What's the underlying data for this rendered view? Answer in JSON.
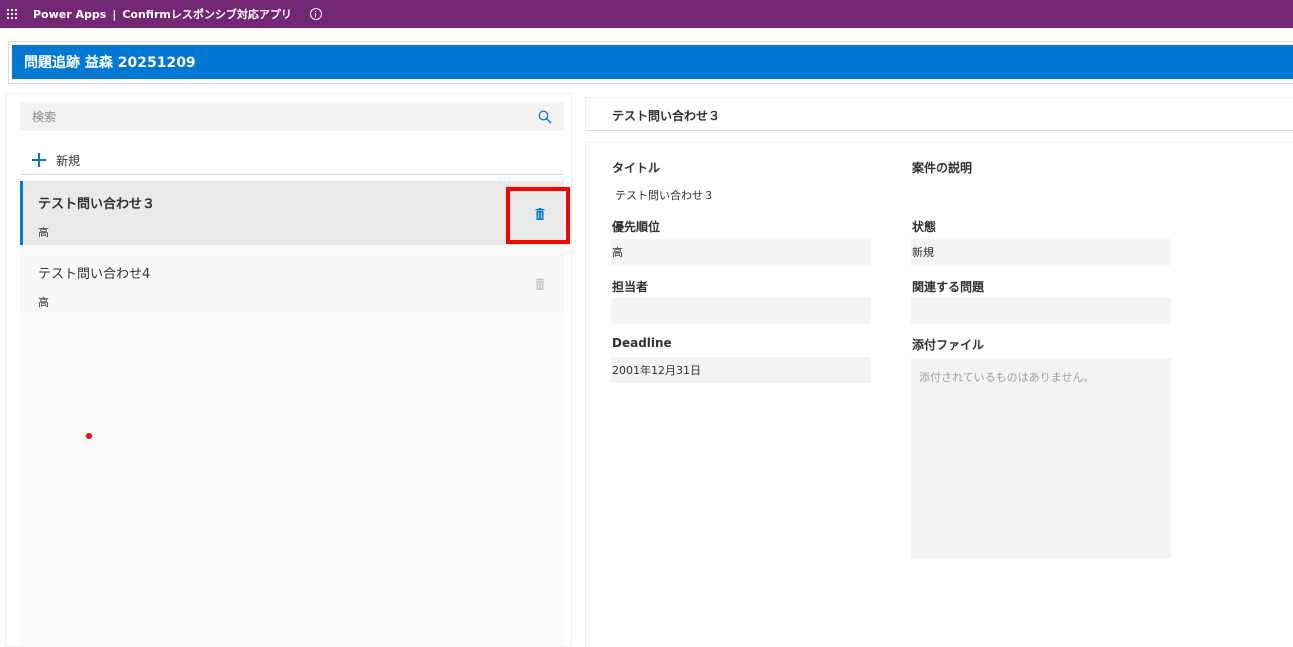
{
  "app": {
    "product": "Power Apps",
    "separator": "|",
    "app_name": "Confirmレスポンシブ対応アプリ"
  },
  "header": {
    "title": "問題追跡 益森 20251209"
  },
  "search": {
    "placeholder": "検索"
  },
  "toolbar": {
    "new_label": "新規"
  },
  "list": {
    "items": [
      {
        "title": "テスト問い合わせ３",
        "priority": "高",
        "selected": true
      },
      {
        "title": "テスト問い合わせ4",
        "priority": "高",
        "selected": false
      }
    ]
  },
  "detail": {
    "header_title": "テスト問い合わせ３",
    "title_label": "タイトル",
    "title_value": "テスト問い合わせ３",
    "description_label": "案件の説明",
    "priority_label": "優先順位",
    "priority_value": "高",
    "status_label": "状態",
    "status_value": "新規",
    "assignee_label": "担当者",
    "assignee_value": "",
    "related_label": "関連する問題",
    "related_value": "",
    "deadline_label": "Deadline",
    "deadline_value": "2001年12月31日",
    "attachments_label": "添付ファイル",
    "attachments_empty": "添付されているものはありません。"
  },
  "colors": {
    "topbar": "#742774",
    "header": "#0078d4",
    "accent": "#0078d4",
    "highlight": "#ff0000"
  },
  "icons": {
    "waffle": "waffle-icon",
    "info": "info-icon",
    "search": "search-icon",
    "add": "plus-icon",
    "delete": "trash-icon"
  }
}
